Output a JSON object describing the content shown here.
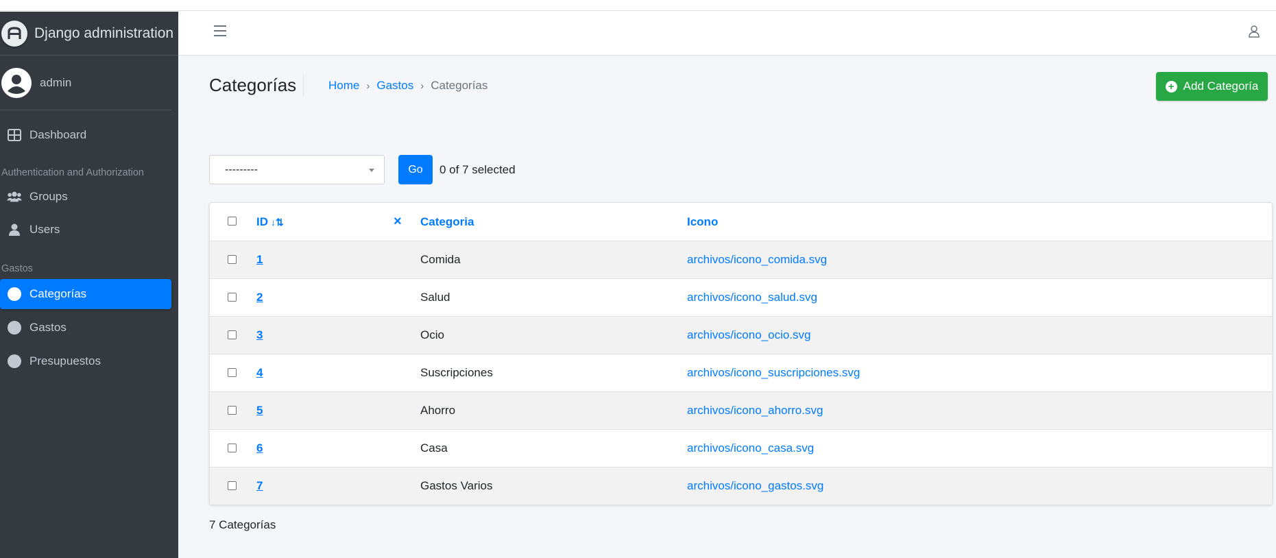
{
  "brand": {
    "title": "Django administration"
  },
  "user": {
    "name": "admin"
  },
  "sidebar": {
    "dashboard": "Dashboard",
    "section_auth": "Authentication and Authorization",
    "groups": "Groups",
    "users": "Users",
    "section_gastos": "Gastos",
    "categorias": "Categorías",
    "gastos": "Gastos",
    "presupuestos": "Presupuestos"
  },
  "header": {
    "title": "Categorías",
    "breadcrumb": [
      "Home",
      "Gastos",
      "Categorías"
    ],
    "add_button": "Add Categoría"
  },
  "actions": {
    "select_value": "---------",
    "go_label": "Go",
    "selected_text": "0 of 7 selected"
  },
  "table": {
    "columns": {
      "id": "ID",
      "categoria": "Categoria",
      "icono": "Icono"
    },
    "rows": [
      {
        "id": "1",
        "categoria": "Comida",
        "icono": "archivos/icono_comida.svg"
      },
      {
        "id": "2",
        "categoria": "Salud",
        "icono": "archivos/icono_salud.svg"
      },
      {
        "id": "3",
        "categoria": "Ocio",
        "icono": "archivos/icono_ocio.svg"
      },
      {
        "id": "4",
        "categoria": "Suscripciones",
        "icono": "archivos/icono_suscripciones.svg"
      },
      {
        "id": "5",
        "categoria": "Ahorro",
        "icono": "archivos/icono_ahorro.svg"
      },
      {
        "id": "6",
        "categoria": "Casa",
        "icono": "archivos/icono_casa.svg"
      },
      {
        "id": "7",
        "categoria": "Gastos Varios",
        "icono": "archivos/icono_gastos.svg"
      }
    ]
  },
  "footer": {
    "count": "7 Categorías"
  },
  "colors": {
    "primary": "#007bff",
    "success": "#28a745",
    "sidebar": "#343a40"
  }
}
